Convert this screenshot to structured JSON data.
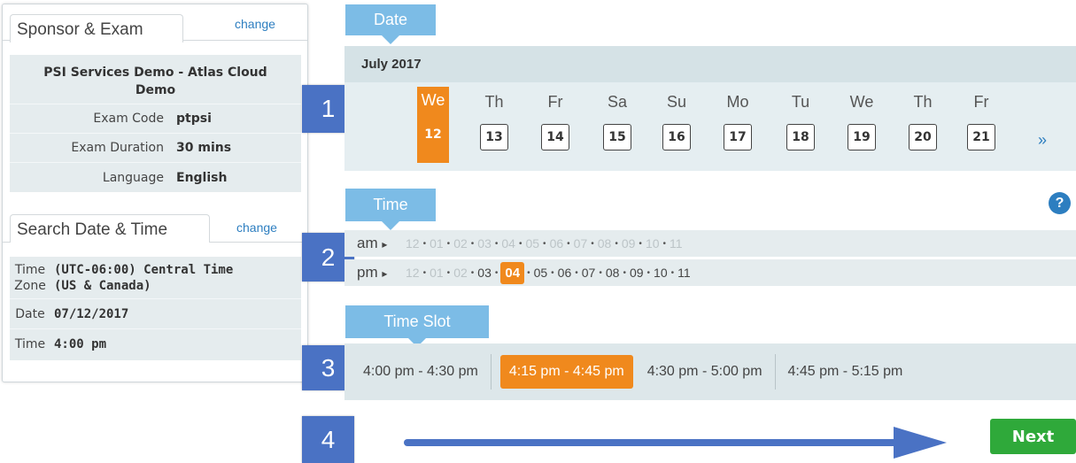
{
  "sponsor_exam": {
    "title": "Sponsor & Exam",
    "change_label": "change",
    "sponsor_name": "PSI Services Demo - Atlas Cloud Demo",
    "rows": [
      {
        "label": "Exam Code",
        "value": "ptpsi"
      },
      {
        "label": "Exam Duration",
        "value": "30 mins"
      },
      {
        "label": "Language",
        "value": "English"
      }
    ]
  },
  "search": {
    "title": "Search Date & Time",
    "change_label": "change",
    "timezone_label_1": "Time",
    "timezone_label_2": "Zone",
    "timezone_value_1": "(UTC-06:00) Central Time",
    "timezone_value_2": "(US & Canada)",
    "date_label": "Date",
    "date_value": "07/12/2017",
    "time_label": "Time",
    "time_value": "4:00 pm"
  },
  "steps": [
    "1",
    "2",
    "3",
    "4"
  ],
  "date_section": {
    "label": "Date",
    "month": "July 2017",
    "days": [
      {
        "name": "We",
        "num": "12",
        "selected": true
      },
      {
        "name": "Th",
        "num": "13"
      },
      {
        "name": "Fr",
        "num": "14"
      },
      {
        "name": "Sa",
        "num": "15"
      },
      {
        "name": "Su",
        "num": "16"
      },
      {
        "name": "Mo",
        "num": "17"
      },
      {
        "name": "Tu",
        "num": "18"
      },
      {
        "name": "We",
        "num": "19"
      },
      {
        "name": "Th",
        "num": "20"
      },
      {
        "name": "Fr",
        "num": "21"
      }
    ],
    "next_label": "»"
  },
  "time_section": {
    "label": "Time",
    "help": "?",
    "am_label": "am",
    "pm_label": "pm",
    "arrow": "▸",
    "am_hours": [
      "12",
      "01",
      "02",
      "03",
      "04",
      "05",
      "06",
      "07",
      "08",
      "09",
      "10",
      "11"
    ],
    "pm_hours": [
      "12",
      "01",
      "02",
      "03",
      "04",
      "05",
      "06",
      "07",
      "08",
      "09",
      "10",
      "11"
    ],
    "pm_enabled_from_index": 3,
    "pm_selected_index": 4
  },
  "slot_section": {
    "label": "Time Slot",
    "slots": [
      "4:00 pm - 4:30 pm",
      "4:15 pm - 4:45 pm",
      "4:30 pm - 5:00 pm",
      "4:45 pm - 5:15 pm"
    ],
    "selected_index": 1
  },
  "next_label": "Next",
  "colors": {
    "accent": "#f0891d",
    "step_badge": "#4a72c4",
    "callout": "#7cbce6",
    "next_button": "#2fa93a",
    "arrow": "#4a72c4"
  }
}
